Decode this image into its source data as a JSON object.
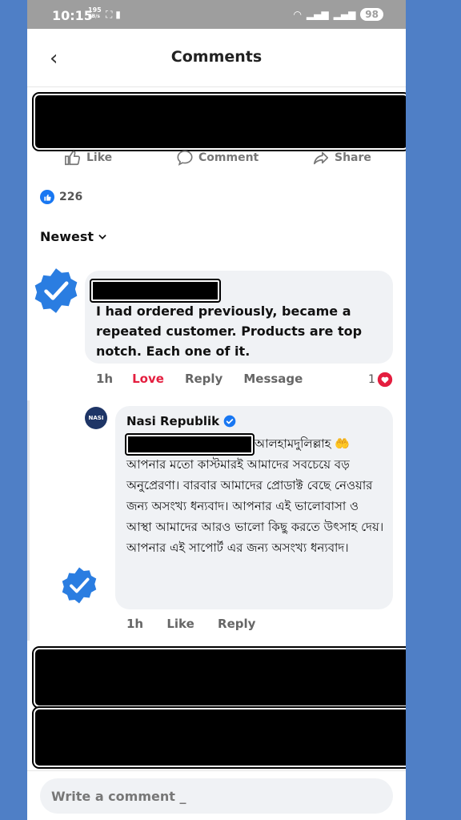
{
  "status_bar": {
    "time": "10:15",
    "speed_value": "195",
    "speed_unit": "KB/s",
    "battery": "98"
  },
  "header": {
    "title": "Comments"
  },
  "post_actions": {
    "like": "Like",
    "comment": "Comment",
    "share": "Share"
  },
  "reactions": {
    "count": "226"
  },
  "sort": {
    "label": "Newest"
  },
  "comment": {
    "text": "I had ordered previously, became a repeated customer. Products are top notch. Each one of it.",
    "time": "1h",
    "reaction_label": "Love",
    "reply_label": "Reply",
    "message_label": "Message",
    "love_count": "1"
  },
  "reply": {
    "avatar_text": "NASI",
    "author": "Nasi Republik",
    "text_first": "আলহামদুলিল্লাহ",
    "text_emoji": "🤲",
    "text_rest": "আপনার মতো কাস্টমারই আমাদের সবচেয়ে বড় অনুপ্রেরণা। বারবার আমাদের প্রোডাক্ট বেছে নেওয়ার জন্য অসংখ্য ধন্যবাদ। আপনার এই ভালোবাসা ও আস্থা আমাদের আরও ভালো কিছু করতে উৎসাহ দেয়। আপনার এই সাপোর্ট এর জন্য অসংখ্য ধন্যবাদ।",
    "time": "1h",
    "like_label": "Like",
    "reply_label": "Reply"
  },
  "composer": {
    "placeholder": "Write a comment _"
  },
  "colors": {
    "accent_blue": "#1877f2",
    "love_red": "#e41e3f",
    "badge_blue": "#2a7de1"
  }
}
